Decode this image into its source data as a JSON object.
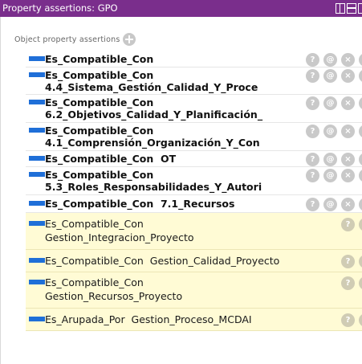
{
  "titlebar": {
    "title": "Property assertions: GPO"
  },
  "section": {
    "label": "Object property assertions"
  },
  "rows": [
    {
      "line1": "Es_Compatible_Con",
      "line2": ""
    },
    {
      "line1": "Es_Compatible_Con",
      "line2": "4.4_Sistema_Gestión_Calidad_Y_Proce"
    },
    {
      "line1": "Es_Compatible_Con",
      "line2": "6.2_Objetivos_Calidad_Y_Planificación_"
    },
    {
      "line1": "Es_Compatible_Con",
      "line2": "4.1_Comprensión_Organización_Y_Con"
    },
    {
      "line1": "Es_Compatible_Con  OT",
      "line2": ""
    },
    {
      "line1": "Es_Compatible_Con",
      "line2": "5.3_Roles_Responsabilidades_Y_Autori"
    },
    {
      "line1": "Es_Compatible_Con  7.1_Recursos",
      "line2": ""
    },
    {
      "line1": "Es_Compatible_Con",
      "line2": "Gestion_Integracion_Proyecto"
    },
    {
      "line1": "Es_Compatible_Con  Gestion_Calidad_Proyecto",
      "line2": ""
    },
    {
      "line1": "Es_Compatible_Con",
      "line2": "Gestion_Recursos_Proyecto"
    },
    {
      "line1": "Es_Arupada_Por  Gestion_Proceso_MCDAI",
      "line2": ""
    }
  ],
  "buttons": {
    "help": "?",
    "annotate": "@",
    "delete": "×",
    "edit": "o"
  },
  "colors": {
    "titlebar": "#7a2e8c",
    "property_swatch": "#1f6fd8",
    "inferred_background": "#fffbd5"
  }
}
